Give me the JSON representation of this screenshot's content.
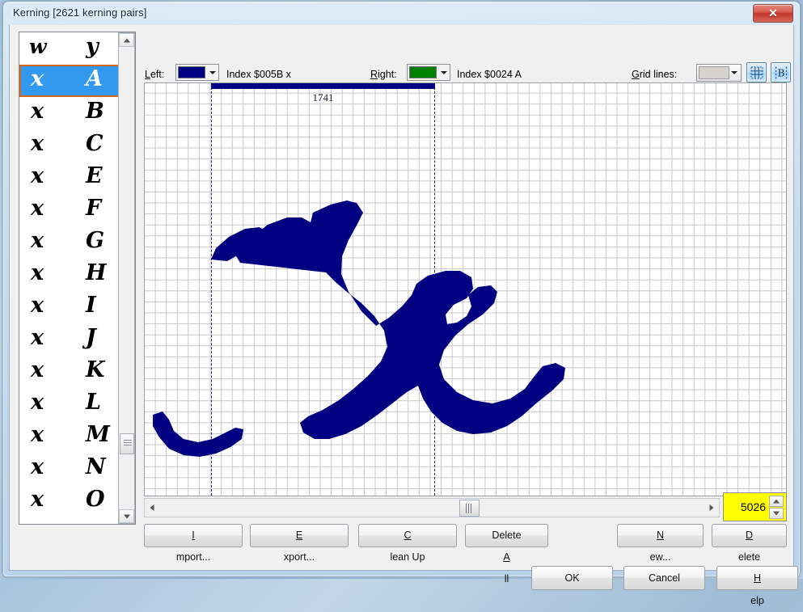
{
  "window": {
    "title": "Kerning [2621 kerning pairs]",
    "close_label": "✕"
  },
  "toolbar": {
    "left_label": "Left:",
    "left_color": "#000080",
    "left_index": "Index $005B x",
    "right_label": "Right:",
    "right_color": "#008000",
    "right_index": "Index $0024 A",
    "gridlines_label": "Grid lines:",
    "gridlines_color": "#d6d3ce",
    "toggle_grid_name": "show-grid",
    "toggle_sidebearings_name": "show-sidebearings"
  },
  "pair_list": {
    "rows": [
      {
        "left": "w",
        "right": "y",
        "selected": false,
        "header": true
      },
      {
        "left": "x",
        "right": "A",
        "selected": true,
        "header": false
      },
      {
        "left": "x",
        "right": "B",
        "selected": false,
        "header": false
      },
      {
        "left": "x",
        "right": "C",
        "selected": false,
        "header": false
      },
      {
        "left": "x",
        "right": "E",
        "selected": false,
        "header": false
      },
      {
        "left": "x",
        "right": "F",
        "selected": false,
        "header": false
      },
      {
        "left": "x",
        "right": "G",
        "selected": false,
        "header": false
      },
      {
        "left": "x",
        "right": "H",
        "selected": false,
        "header": false
      },
      {
        "left": "x",
        "right": "I",
        "selected": false,
        "header": false
      },
      {
        "left": "x",
        "right": "J",
        "selected": false,
        "header": false
      },
      {
        "left": "x",
        "right": "K",
        "selected": false,
        "header": false
      },
      {
        "left": "x",
        "right": "L",
        "selected": false,
        "header": false
      },
      {
        "left": "x",
        "right": "M",
        "selected": false,
        "header": false
      },
      {
        "left": "x",
        "right": "N",
        "selected": false,
        "header": false
      },
      {
        "left": "x",
        "right": "O",
        "selected": false,
        "header": false
      }
    ]
  },
  "canvas": {
    "kern_display_value": "1741",
    "glyph_color": "#000080",
    "sidebearing_color": "#1b1b7a",
    "grid_color": "#c8c8c8"
  },
  "spinner": {
    "value": "5026",
    "up_label": "▲",
    "down_label": "▼",
    "background": "#ffff00"
  },
  "buttons": {
    "import": "Import...",
    "export": "Export...",
    "cleanup": "Clean Up",
    "delete_all": "Delete All",
    "new": "New...",
    "delete": "Delete",
    "ok": "OK",
    "cancel": "Cancel",
    "help": "Help"
  }
}
